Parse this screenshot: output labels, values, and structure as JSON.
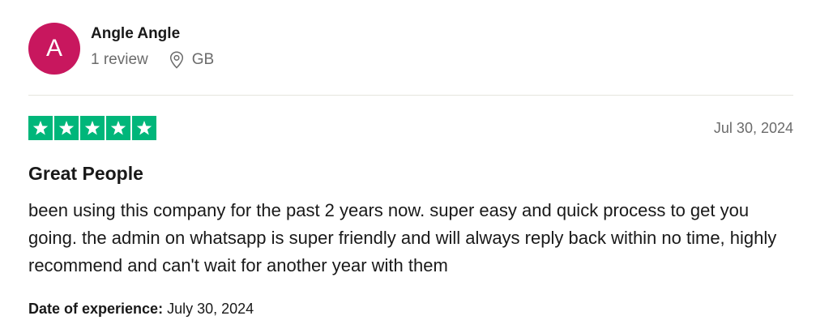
{
  "reviewer": {
    "initial": "A",
    "avatar_color": "#c8175e",
    "name": "Angle Angle",
    "review_count": "1 review",
    "location_icon": "location-pin-icon",
    "country": "GB"
  },
  "review": {
    "rating": 5,
    "rating_max": 5,
    "star_color": "#00b67a",
    "date": "Jul 30, 2024",
    "title": "Great People",
    "body": "been using this company for the past 2 years now. super easy and quick process to get you going. the admin on whatsapp is super friendly and will always reply back within no time, highly recommend and can't wait for another year with them",
    "experience_label": "Date of experience:",
    "experience_date": "July 30, 2024"
  }
}
